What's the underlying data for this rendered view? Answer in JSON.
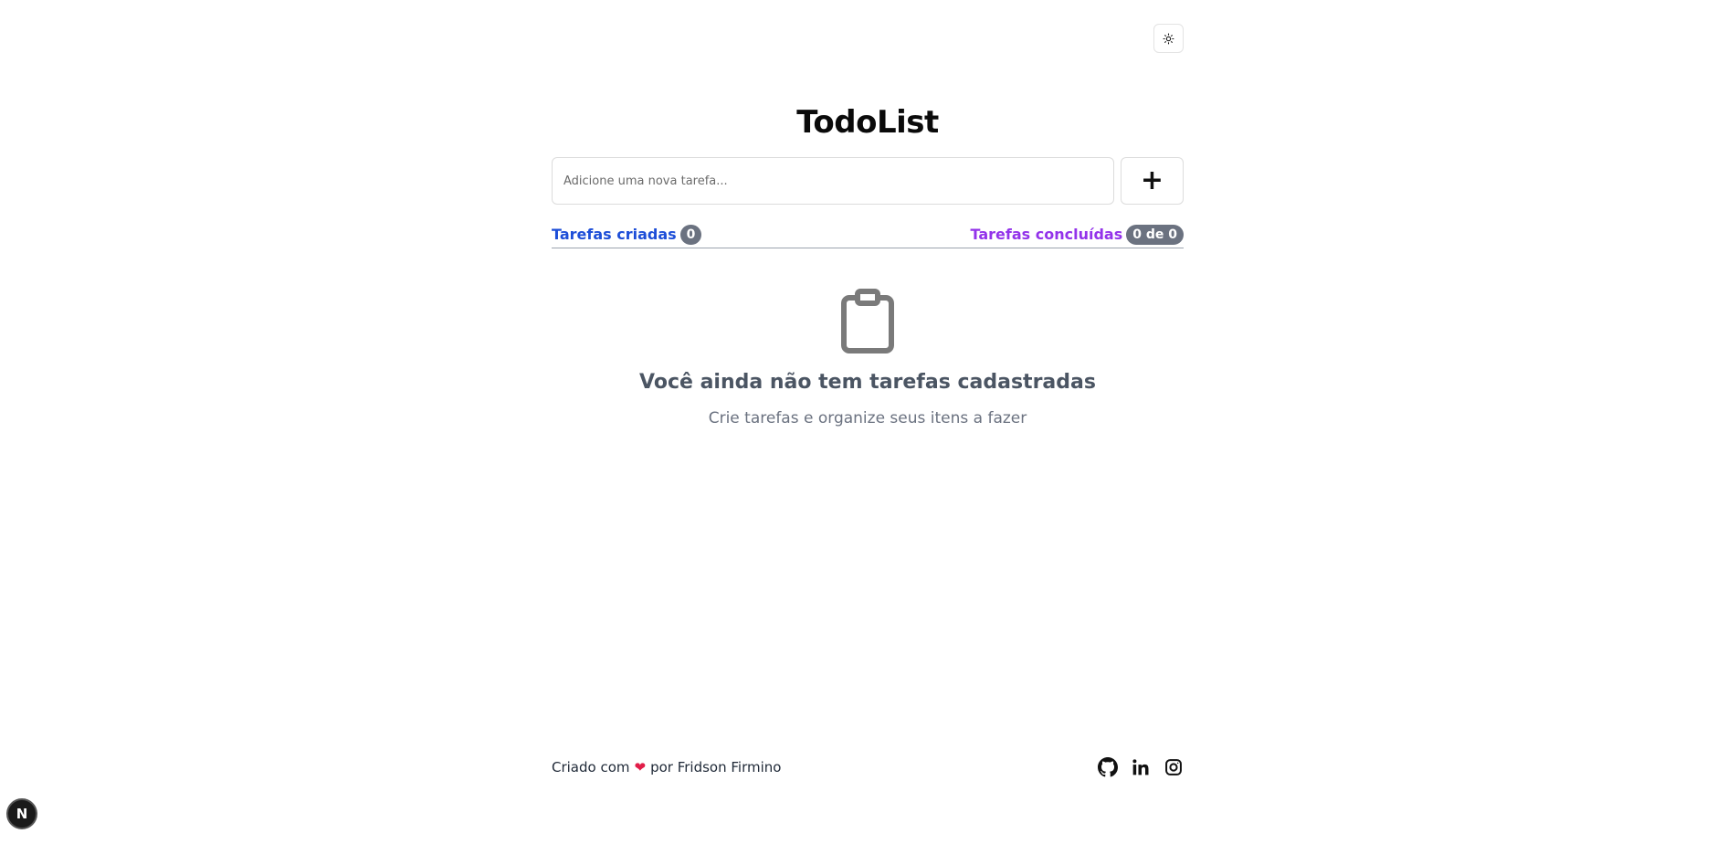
{
  "app": {
    "title": "TodoList"
  },
  "header": {
    "theme_toggle_icon": "sun-icon"
  },
  "new_task": {
    "placeholder": "Adicione uma nova tarefa...",
    "value": "",
    "add_label": "+"
  },
  "stats": {
    "created_label": "Tarefas criadas",
    "created_count": "0",
    "done_label": "Tarefas concluídas",
    "done_count": "0 de 0"
  },
  "empty_state": {
    "icon": "clipboard-icon",
    "title": "Você ainda não tem tarefas cadastradas",
    "subtitle": "Crie tarefas e organize seus itens a fazer"
  },
  "footer": {
    "credit_prefix": "Criado com",
    "credit_suffix": "por Fridson Firmino",
    "heart": "❤",
    "socials": [
      "github-icon",
      "linkedin-icon",
      "instagram-icon"
    ]
  },
  "dev_badge": {
    "label": "N"
  },
  "colors": {
    "created_accent": "#1d4ed8",
    "done_accent": "#9333ea",
    "badge_bg": "#6b7280",
    "heart": "#e11d48"
  }
}
